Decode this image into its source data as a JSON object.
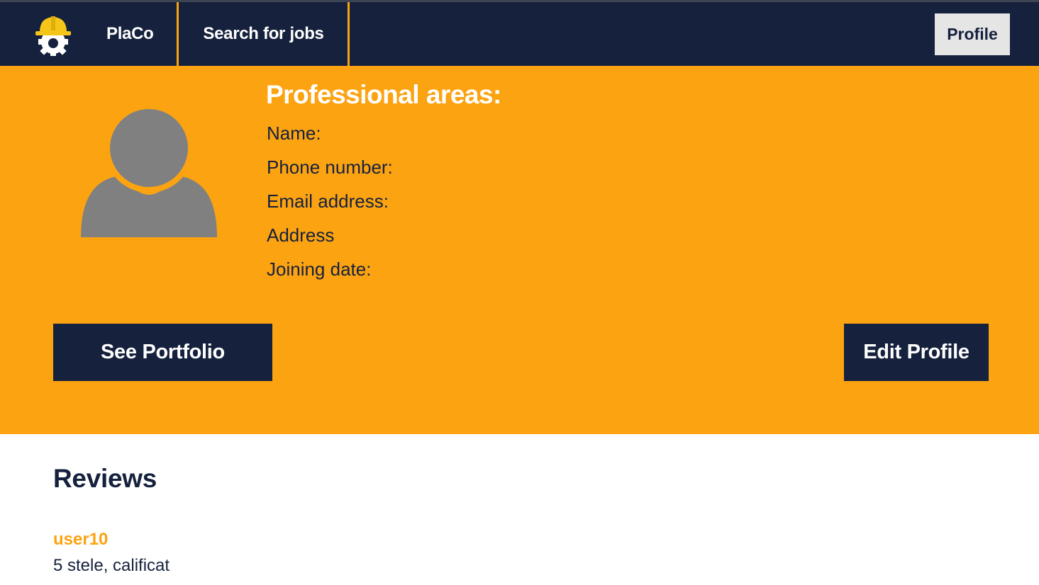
{
  "navbar": {
    "brand": "PlaCo",
    "links": [
      {
        "label": "Search for jobs"
      }
    ],
    "profile_label": "Profile",
    "logo_icon": "hardhat-gear-icon"
  },
  "colors": {
    "navy": "#15213d",
    "orange": "#fca311",
    "light_gray": "#e5e5e5",
    "avatar_gray": "#808080"
  },
  "profile": {
    "avatar_icon": "user-avatar-icon",
    "areas_title": "Professional areas:",
    "fields": [
      {
        "label": "Name:"
      },
      {
        "label": "Phone number:"
      },
      {
        "label": "Email address:"
      },
      {
        "label": "Address"
      },
      {
        "label": "Joining date:"
      }
    ],
    "see_portfolio_label": "See Portfolio",
    "edit_profile_label": "Edit Profile"
  },
  "reviews": {
    "title": "Reviews",
    "items": [
      {
        "user": "user10",
        "text": "5 stele, calificat"
      }
    ]
  }
}
